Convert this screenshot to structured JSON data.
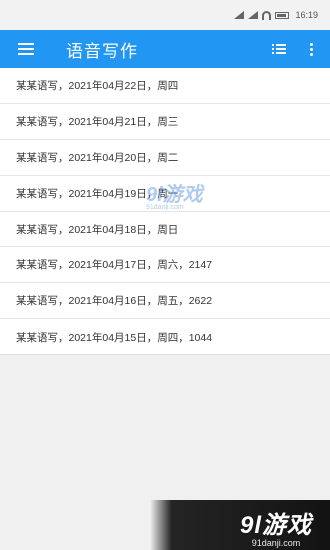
{
  "status_bar": {
    "time": "16:19"
  },
  "app_bar": {
    "title": "语音写作",
    "menu_icon": "hamburger-menu-icon",
    "list_icon": "list-view-icon",
    "more_icon": "more-vert-icon"
  },
  "entries": [
    "某某语写，2021年04月22日，周四",
    "某某语写，2021年04月21日，周三",
    "某某语写，2021年04月20日，周二",
    "某某语写，2021年04月19日，周一",
    "某某语写，2021年04月18日，周日",
    "某某语写，2021年04月17日，周六，2147",
    "某某语写，2021年04月16日，周五，2622",
    "某某语写，2021年04月15日，周四，1044"
  ],
  "watermark": {
    "brand": "9l游戏",
    "site": "91danji.com"
  },
  "colors": {
    "primary": "#2196f3",
    "background": "#f0f0f0",
    "list_background": "#ffffff"
  }
}
